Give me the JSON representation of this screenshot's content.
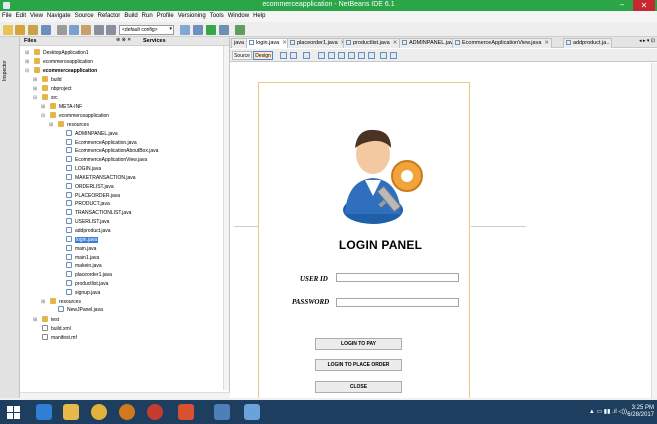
{
  "window": {
    "title": "ecommerceapplication - NetBeans IDE 6.1",
    "min_glyph": "–",
    "close_glyph": "✕"
  },
  "menu": [
    "File",
    "Edit",
    "View",
    "Navigate",
    "Source",
    "Refactor",
    "Build",
    "Run",
    "Profile",
    "Versioning",
    "Tools",
    "Window",
    "Help"
  ],
  "toolbar": {
    "config_value": "<default config>"
  },
  "side_strip": {
    "label": "Inspector"
  },
  "files_panel": {
    "tab_files": "Files",
    "tab_controls": "⊕ ⊗ ✕",
    "tab_services": "Services",
    "tree": [
      {
        "label": "DesktopApplication1",
        "icon": "folder"
      },
      {
        "label": "ecommerceapplication",
        "icon": "folder"
      },
      {
        "label": "ecommerceapplication",
        "icon": "folder",
        "bold": true
      },
      {
        "label": "build",
        "icon": "folder"
      },
      {
        "label": "nbproject",
        "icon": "folder"
      },
      {
        "label": "src",
        "icon": "folder"
      },
      {
        "label": "META-INF",
        "icon": "folder"
      },
      {
        "label": "ecommerceapplication",
        "icon": "folder"
      },
      {
        "label": "resources",
        "icon": "folder"
      },
      {
        "label": "ADMINPANEL.java",
        "icon": "java"
      },
      {
        "label": "EcommerceApplication.java",
        "icon": "java"
      },
      {
        "label": "EcommerceApplicationAboutBox.java",
        "icon": "java"
      },
      {
        "label": "EcommerceApplicationView.java",
        "icon": "java"
      },
      {
        "label": "LOGIN.java",
        "icon": "java"
      },
      {
        "label": "MAKETRANSACTION.java",
        "icon": "java"
      },
      {
        "label": "ORDERLIST.java",
        "icon": "java"
      },
      {
        "label": "PLACEORDER.java",
        "icon": "java"
      },
      {
        "label": "PRODUCT.java",
        "icon": "java"
      },
      {
        "label": "TRANSACTIONLIST.java",
        "icon": "java"
      },
      {
        "label": "USERLIST.java",
        "icon": "java"
      },
      {
        "label": "addproduct.java",
        "icon": "java"
      },
      {
        "label": "login.java",
        "icon": "java",
        "selected": true
      },
      {
        "label": "main.java",
        "icon": "java"
      },
      {
        "label": "main1.java",
        "icon": "java"
      },
      {
        "label": "makein.java",
        "icon": "java"
      },
      {
        "label": "placeorder1.java",
        "icon": "java"
      },
      {
        "label": "productlist.java",
        "icon": "java"
      },
      {
        "label": "signup.java",
        "icon": "java"
      },
      {
        "label": "resources",
        "icon": "folder"
      },
      {
        "label": "NewJPanel.java",
        "icon": "java"
      },
      {
        "label": "test",
        "icon": "folder"
      },
      {
        "label": "build.xml",
        "icon": "xml"
      },
      {
        "label": "manifest.mf",
        "icon": "xml"
      }
    ]
  },
  "editor": {
    "doc_tabs": [
      {
        "label": "java",
        "close": ""
      },
      {
        "label": "login.java",
        "close": "✕",
        "active": true
      },
      {
        "label": "placeorder1.java",
        "close": "✕"
      },
      {
        "label": "productlist.java",
        "close": "✕"
      },
      {
        "label": "ADMINPANEL.java",
        "close": "✕"
      },
      {
        "label": "EcommerceApplicationView.java",
        "close": "✕"
      },
      {
        "label": "addproduct.ja..",
        "close": ""
      }
    ],
    "tab_nav": "◂ ▸ ▾ ⊡",
    "source_label": "Source",
    "design_label": "Design"
  },
  "login_panel": {
    "title": "LOGIN PANEL",
    "user_id_label": "USER ID",
    "password_label": "PASSWORD",
    "user_id_value": "",
    "password_value": "",
    "buttons": {
      "pay": "LOGIN TO PAY",
      "order": "LOGIN TO PLACE ORDER",
      "close": "CLOSE"
    }
  },
  "taskbar": {
    "tray_text": "▲  ▭  ▮▮  .ıl  ◁))",
    "time": "3:25 PM",
    "date": "6/28/2017"
  },
  "colors": {
    "titlebar": "#2aa548",
    "close": "#c7272e",
    "taskbar": "#1d3e5e",
    "selection": "#3b7dd8"
  }
}
